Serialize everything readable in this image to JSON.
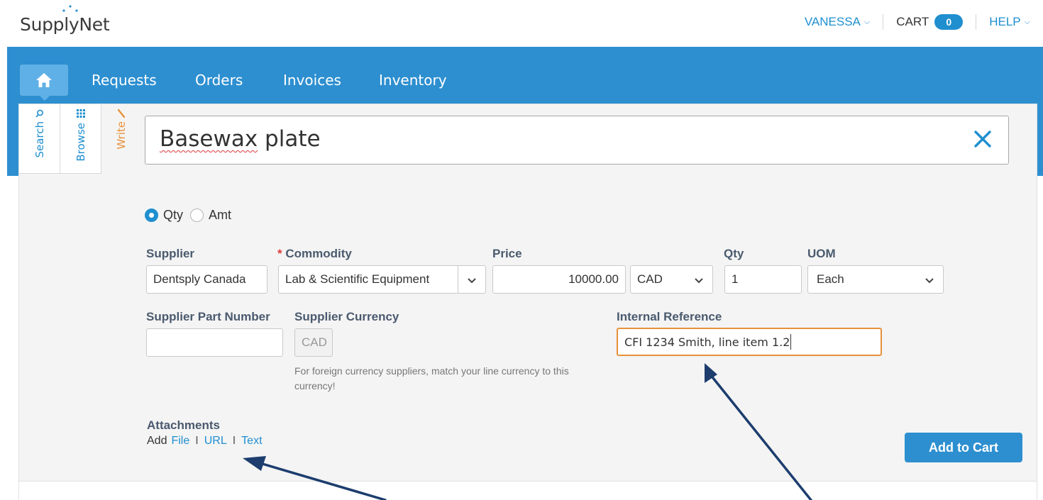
{
  "header": {
    "logo": "SupplyNet",
    "user_menu": "VANESSA",
    "cart_label": "CART",
    "cart_count": "0",
    "help_menu": "HELP"
  },
  "nav": {
    "home_icon": "home-icon",
    "items": [
      "Requests",
      "Orders",
      "Invoices",
      "Inventory"
    ]
  },
  "side_tabs": {
    "search": "Search",
    "browse": "Browse",
    "write": "Write"
  },
  "item": {
    "title_misspelled": "Basewax",
    "title_rest": " plate"
  },
  "radios": {
    "qty": "Qty",
    "amt": "Amt",
    "selected": "Qty"
  },
  "form": {
    "supplier_label": "Supplier",
    "supplier_value": "Dentsply Canada",
    "commodity_required_mark": "*",
    "commodity_label": "Commodity",
    "commodity_value": "Lab & Scientific Equipment",
    "price_label": "Price",
    "price_value": "10000.00",
    "currency_value": "CAD",
    "qty_label": "Qty",
    "qty_value": "1",
    "uom_label": "UOM",
    "uom_value": "Each",
    "part_number_label": "Supplier Part Number",
    "part_number_value": "",
    "supplier_currency_label": "Supplier Currency",
    "supplier_currency_value": "CAD",
    "supplier_currency_help": "For foreign currency suppliers, match your line currency to this currency!",
    "internal_reference_label": "Internal Reference",
    "internal_reference_value": "CFI 1234 Smith, line item 1.2"
  },
  "attachments": {
    "title": "Attachments",
    "add": "Add",
    "file": "File",
    "url": "URL",
    "text": "Text",
    "separator": "I"
  },
  "actions": {
    "add_to_cart": "Add to Cart"
  },
  "colors": {
    "brand_blue": "#2d8fd0",
    "link_blue": "#1f8fd0",
    "active_orange": "#e8913a",
    "arrow_navy": "#1c3d6e"
  }
}
